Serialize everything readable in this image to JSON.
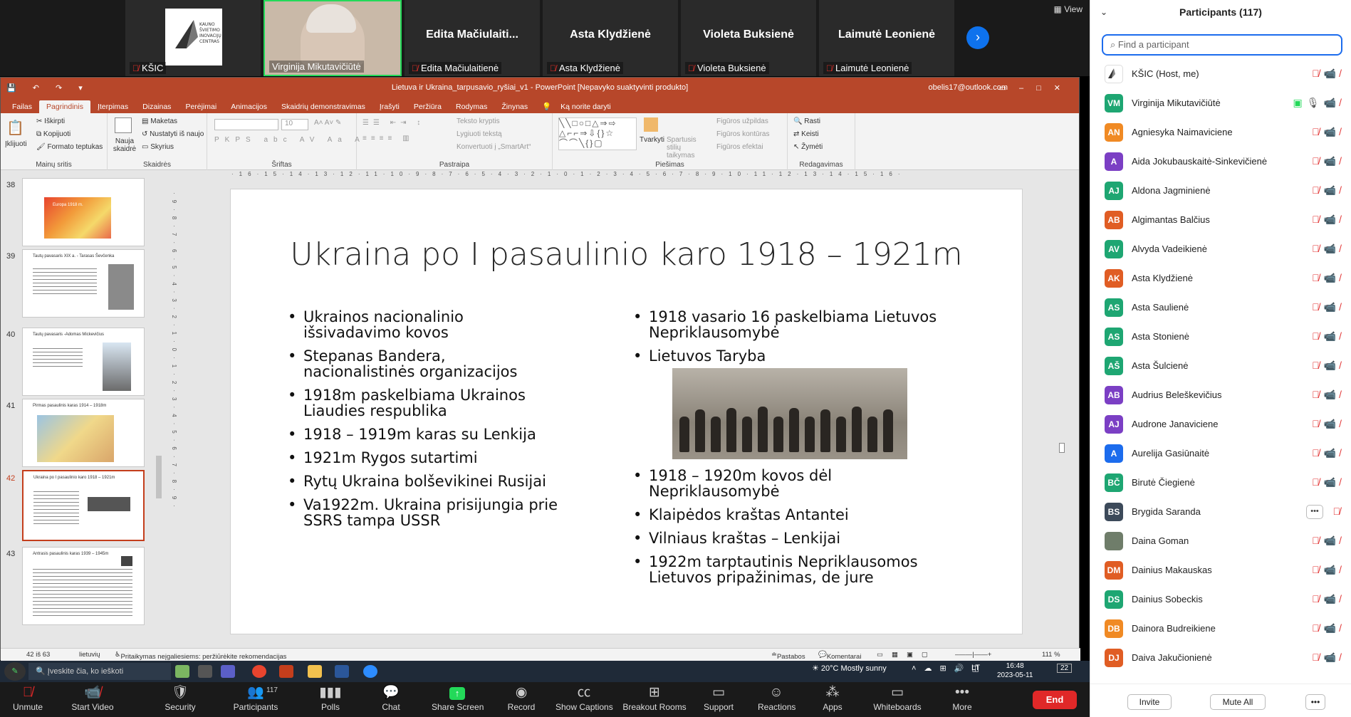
{
  "video": {
    "view_label": "View",
    "tiles": [
      {
        "name": "KŠIC",
        "logo_text": "KAUNO ŠVIETIMO INOVACIJŲ CENTRAS"
      },
      {
        "name": "Virginija Mikutavičiūtė"
      },
      {
        "name": "Edita Mačiulaitienė",
        "big": "Edita  Mačiulaiti..."
      },
      {
        "name": "Asta Klydžienė",
        "big": "Asta Klydžienė"
      },
      {
        "name": "Violeta Buksienė",
        "big": "Violeta Buksienė"
      },
      {
        "name": "Laimutė Leonienė",
        "big": "Laimutė Leonienė"
      }
    ]
  },
  "ppt": {
    "title": "Lietuva ir Ukraina_tarpusavio_ryšiai_v1  -  PowerPoint [Nepavyko suaktyvinti produkto]",
    "account": "obelis17@outlook.com",
    "tabs": [
      "Failas",
      "Pagrindinis",
      "Įterpimas",
      "Dizainas",
      "Perėjimai",
      "Animacijos",
      "Skaidrių demonstravimas",
      "Įrašyti",
      "Peržiūra",
      "Rodymas",
      "Žinynas",
      "Ką norite daryti"
    ],
    "ribbon": {
      "clipboard": {
        "paste": "Įklijuoti",
        "cut": "Iškirpti",
        "copy": "Kopijuoti",
        "format": "Formato teptukas",
        "label": "Mainų sritis"
      },
      "slides": {
        "new": "Nauja skaidrė",
        "layout": "Maketas",
        "reset": "Nustatyti iš naujo",
        "section": "Skyrius",
        "label": "Skaidrės"
      },
      "font": {
        "label": "Šriftas",
        "size": "10"
      },
      "paragraph": {
        "direction": "Teksto kryptis",
        "align": "Lygiuoti tekstą",
        "smartart": "Konvertuoti į „SmartArt“",
        "label": "Pastraipa"
      },
      "drawing": {
        "arrange": "Tvarkyti",
        "styles": "Spartusis stilių taikymas",
        "fill": "Figūros užpildas",
        "outline": "Figūros kontūras",
        "effects": "Figūros efektai",
        "label": "Piešimas"
      },
      "editing": {
        "find": "Rasti",
        "replace": "Keisti",
        "select": "Žymėti",
        "label": "Redagavimas"
      }
    },
    "thumbs": [
      {
        "num": "38",
        "title": "Europa 1918 m."
      },
      {
        "num": "39",
        "title": "Tautų pavasaris XIX a. - Tarasas Ševčenka"
      },
      {
        "num": "40",
        "title": "Tautų pavasaris -Adomas Mickevičius"
      },
      {
        "num": "41",
        "title": "Pirmas pasaulinis karas 1914 – 1918m"
      },
      {
        "num": "42",
        "title": "Ukraina po I pasaulinio karo 1918 – 1921m"
      },
      {
        "num": "43",
        "title": "Antrasis pasaulinis karas 1939 – 1945m"
      }
    ],
    "ruler_h": "·16·15·14·13·12·11·10·9·8·7·6·5·4·3·2·1·0·1·2·3·4·5·6·7·8·9·10·11·12·13·14·15·16·",
    "ruler_v": "·9·8·7·6·5·4·3·2·1·0·1·2·3·4·5·6·7·8·9·",
    "slide": {
      "title": "Ukraina po I pasaulinio  karo 1918 – 1921m",
      "left": [
        " Ukrainos nacionalinio išsivadavimo kovos",
        "Stepanas Bandera, nacionalistinės organizacijos",
        " 1918m paskelbiama Ukrainos Liaudies respublika",
        " 1918 – 1919m karas su Lenkija",
        " 1921m Rygos sutartimi",
        " Rytų Ukraina bolševikinei Rusijai",
        "Va1922m.  Ukraina prisijungia prie SSRS tampa USSR"
      ],
      "right_top": [
        "1918 vasario 16 paskelbiama Lietuvos Nepriklausomybė",
        " Lietuvos Taryba"
      ],
      "right_bottom": [
        "1918 – 1920m kovos dėl Nepriklausomybė",
        " Klaipėdos kraštas Antantei",
        " Vilniaus kraštas – Lenkijai",
        "1922m  tarptautinis Nepriklausomos Lietuvos pripažinimas, de jure"
      ]
    },
    "status": {
      "slide": "42 iš 63",
      "lang": "lietuvių",
      "access": "Pritaikymas neįgaliesiems: peržiūrėkite rekomendacijas",
      "notes": "Pastabos",
      "comments": "Komentarai",
      "zoom": "111 %"
    }
  },
  "taskbar": {
    "search": "Įveskite čia, ko ieškoti",
    "weather": "20°C  Mostly sunny",
    "lang": "LT",
    "time": "16:48",
    "date": "2023-05-11",
    "notif": "22"
  },
  "zoom_bar": {
    "buttons": [
      "Unmute",
      "Start Video",
      "Security",
      "Participants",
      "Polls",
      "Chat",
      "Share Screen",
      "Record",
      "Show Captions",
      "Breakout Rooms",
      "Support",
      "Reactions",
      "Apps",
      "Whiteboards",
      "More"
    ],
    "participants_count": "117",
    "end": "End"
  },
  "panel": {
    "title": "Participants (117)",
    "search_placeholder": "Find a participant",
    "participants": [
      {
        "name": "KŠIC (Host, me)",
        "initials": "",
        "color": "#ffffff"
      },
      {
        "name": "Virginija Mikutavičiūtė",
        "initials": "VM",
        "color": "#1ea672"
      },
      {
        "name": "Agniesyka Naimaviciene",
        "initials": "AN",
        "color": "#f08a24"
      },
      {
        "name": "Aida Jokubauskaitė-Sinkevičienė",
        "initials": "A",
        "color": "#7b3fc4"
      },
      {
        "name": "Aldona Jagminienė",
        "initials": "AJ",
        "color": "#1ea672"
      },
      {
        "name": "Algimantas Balčius",
        "initials": "AB",
        "color": "#e05d24"
      },
      {
        "name": "Alvyda Vadeikienė",
        "initials": "AV",
        "color": "#1ea672"
      },
      {
        "name": "Asta Klydžienė",
        "initials": "AK",
        "color": "#e05d24"
      },
      {
        "name": "Asta Saulienė",
        "initials": "AS",
        "color": "#1ea672"
      },
      {
        "name": "Asta Stonienė",
        "initials": "AS",
        "color": "#1ea672"
      },
      {
        "name": "Asta Šulcienė",
        "initials": "AŠ",
        "color": "#1ea672"
      },
      {
        "name": "Audrius Beleškevičius",
        "initials": "AB",
        "color": "#7b3fc4"
      },
      {
        "name": "Audrone Janaviciene",
        "initials": "AJ",
        "color": "#7b3fc4"
      },
      {
        "name": "Aurelija Gasiūnaitė",
        "initials": "A",
        "color": "#1c6ced"
      },
      {
        "name": "Birutė Čiegienė",
        "initials": "BČ",
        "color": "#1ea672"
      },
      {
        "name": "Brygida Saranda",
        "initials": "BS",
        "color": "#3c4a5a"
      },
      {
        "name": "Daina Goman",
        "initials": "",
        "color": "#6f7d6a"
      },
      {
        "name": "Dainius Makauskas",
        "initials": "DM",
        "color": "#e05d24"
      },
      {
        "name": "Dainius Sobeckis",
        "initials": "DS",
        "color": "#1ea672"
      },
      {
        "name": "Dainora Budreikiene",
        "initials": "DB",
        "color": "#f08a24"
      },
      {
        "name": "Daiva Jakučionienė",
        "initials": "DJ",
        "color": "#e05d24"
      }
    ],
    "invite": "Invite",
    "mute_all": "Mute All"
  }
}
